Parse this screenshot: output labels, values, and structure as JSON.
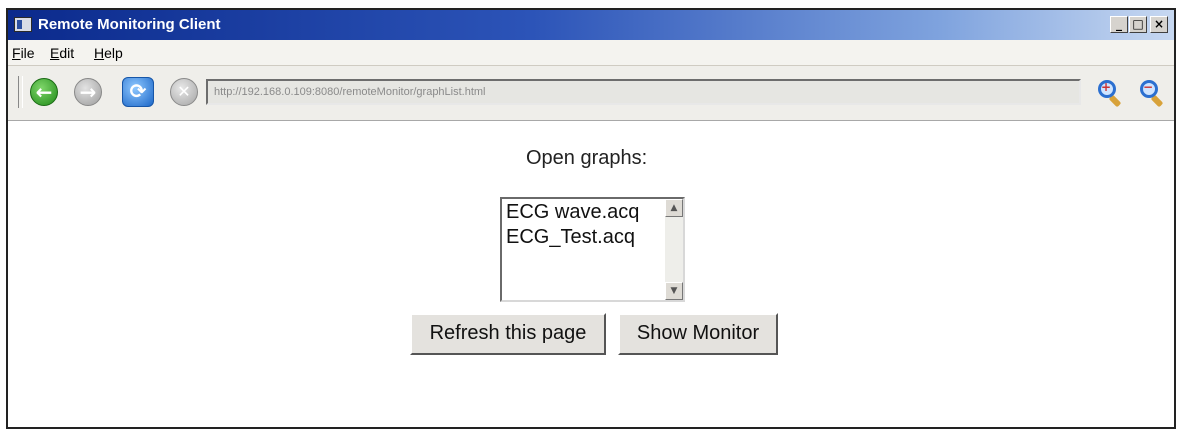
{
  "window": {
    "title": "Remote Monitoring Client",
    "controls": {
      "minimize": "_",
      "maximize": "□",
      "close": "×"
    }
  },
  "menubar": {
    "items": [
      {
        "label": "File"
      },
      {
        "label": "Edit"
      },
      {
        "label": "Help"
      }
    ]
  },
  "toolbar": {
    "back_icon": "arrow-left-icon",
    "forward_icon": "arrow-right-icon",
    "refresh_icon": "refresh-icon",
    "stop_icon": "stop-icon",
    "address": "http://192.168.0.109:8080/remoteMonitor/graphList.html",
    "zoom_in_icon": "zoom-in-icon",
    "zoom_out_icon": "zoom-out-icon"
  },
  "main": {
    "heading": "Open graphs:",
    "graphs": [
      {
        "label": "ECG wave.acq"
      },
      {
        "label": "ECG_Test.acq"
      }
    ],
    "refresh_button": "Refresh this page",
    "monitor_button": "Show Monitor"
  },
  "colors": {
    "titlebar_start": "#0b2a8c",
    "titlebar_end": "#c7d8f1",
    "back_button": "#1f8a18",
    "refresh_button": "#1c67c8"
  }
}
